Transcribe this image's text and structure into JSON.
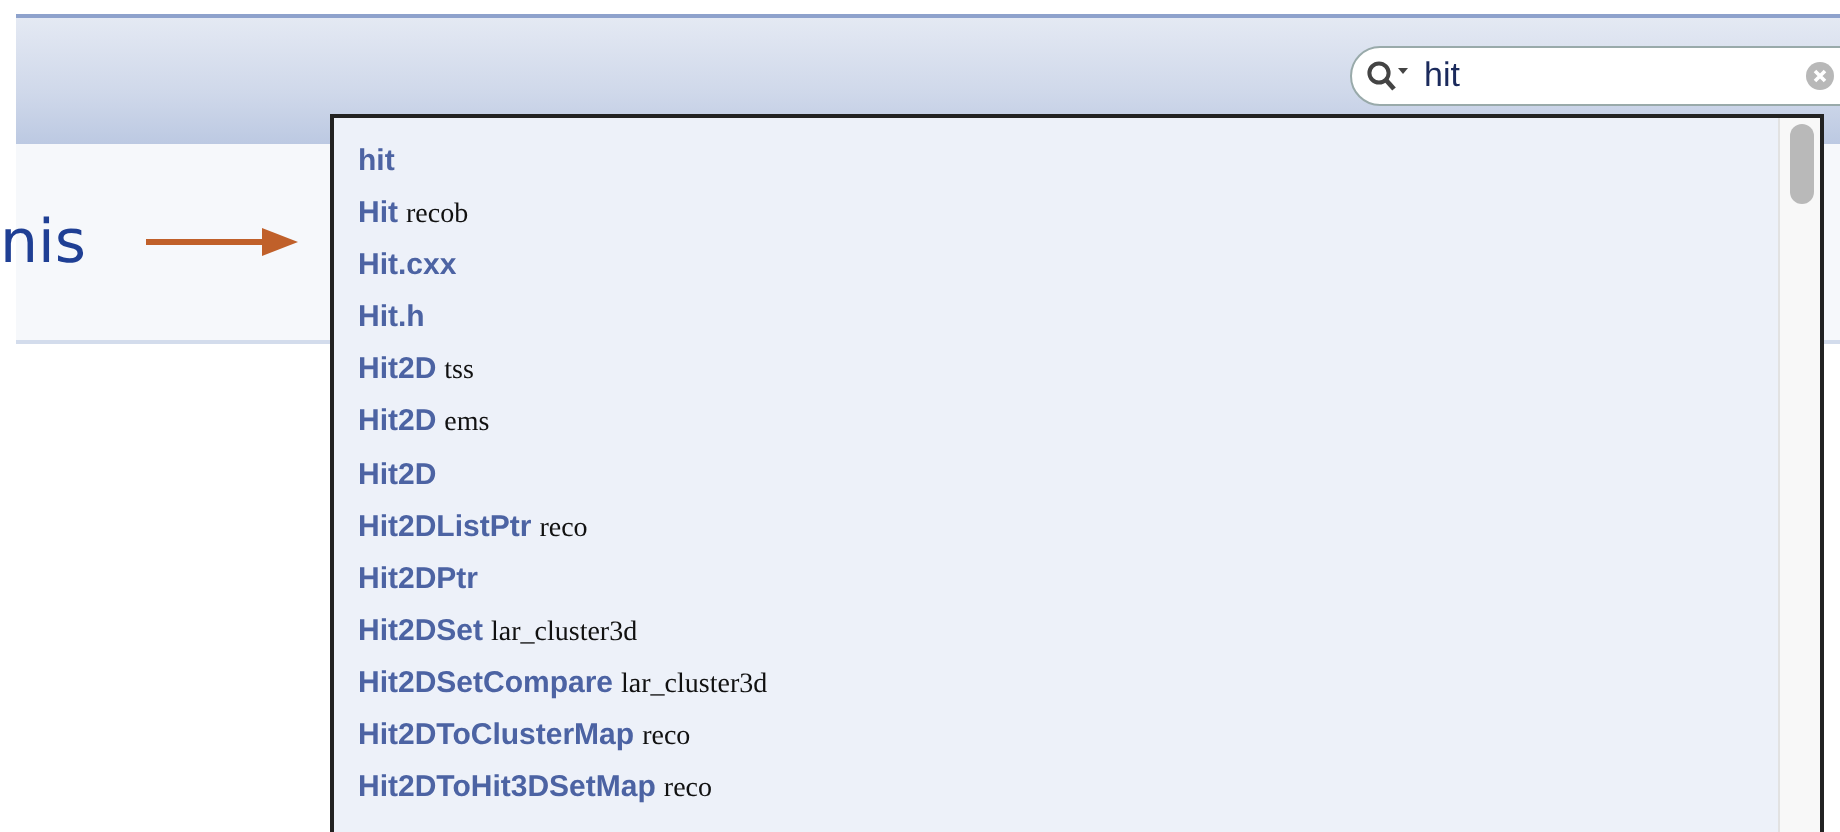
{
  "caption": "nis",
  "search": {
    "value": "hit"
  },
  "suggestions": [
    {
      "name": "hit"
    },
    {
      "name": "Hit",
      "scope": "recob"
    },
    {
      "name": "Hit.cxx"
    },
    {
      "name": "Hit.h"
    },
    {
      "name": "Hit2D",
      "scope": "tss"
    },
    {
      "name": "Hit2D",
      "scope": "ems"
    },
    {
      "name": "Hit2D"
    },
    {
      "name": "Hit2DListPtr",
      "scope": "reco"
    },
    {
      "name": "Hit2DPtr"
    },
    {
      "name": "Hit2DSet",
      "scope": "lar_cluster3d"
    },
    {
      "name": "Hit2DSetCompare",
      "scope": "lar_cluster3d"
    },
    {
      "name": "Hit2DToClusterMap",
      "scope": "reco"
    },
    {
      "name": "Hit2DToHit3DSetMap",
      "scope": "reco"
    }
  ]
}
